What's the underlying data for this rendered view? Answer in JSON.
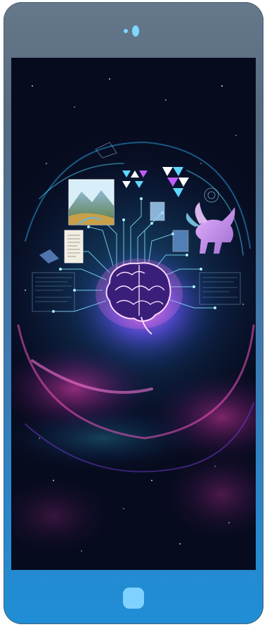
{
  "device": {
    "frame_color_top": "#66788a",
    "frame_color_bottom": "#1f8ed6",
    "accent_color": "#7fd2ff"
  },
  "screen": {
    "background_color": "#070b1e",
    "artwork": {
      "subject": "glowing-brain-network",
      "icons": [
        "brain-icon",
        "landscape-image",
        "document-image",
        "creature-image",
        "geometric-tiles"
      ]
    }
  }
}
